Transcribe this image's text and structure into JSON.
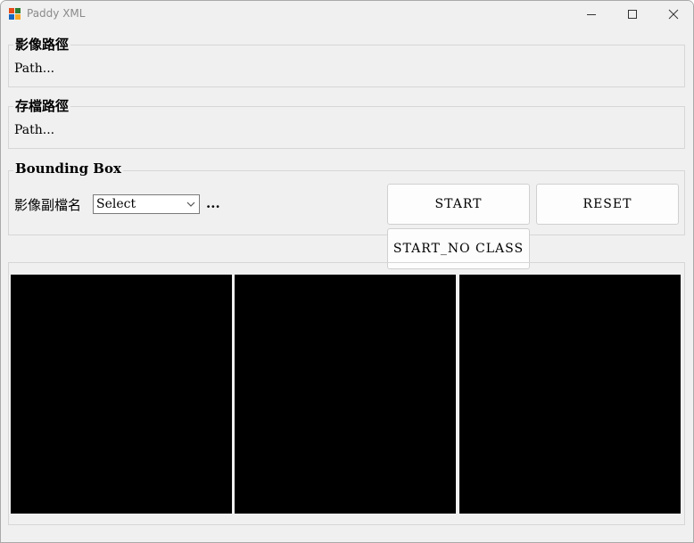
{
  "window": {
    "title": "Paddy XML",
    "icon": "windows-forms-app-icon",
    "controls": [
      "minimize-icon",
      "maximize-icon",
      "close-icon"
    ]
  },
  "image_path_group": {
    "legend": "影像路徑",
    "value": "Path..."
  },
  "save_path_group": {
    "legend": "存檔路徑",
    "value": "Path..."
  },
  "bbox_group": {
    "legend": "Bounding Box",
    "ext_label": "影像副檔名",
    "ext_select": {
      "value": "Select"
    },
    "browse_label": "...",
    "start_label": "START",
    "reset_label": "RESET",
    "start_no_class_label": "START_NO CLASS"
  },
  "image_panels": {
    "count": 3,
    "color": "#000000"
  }
}
